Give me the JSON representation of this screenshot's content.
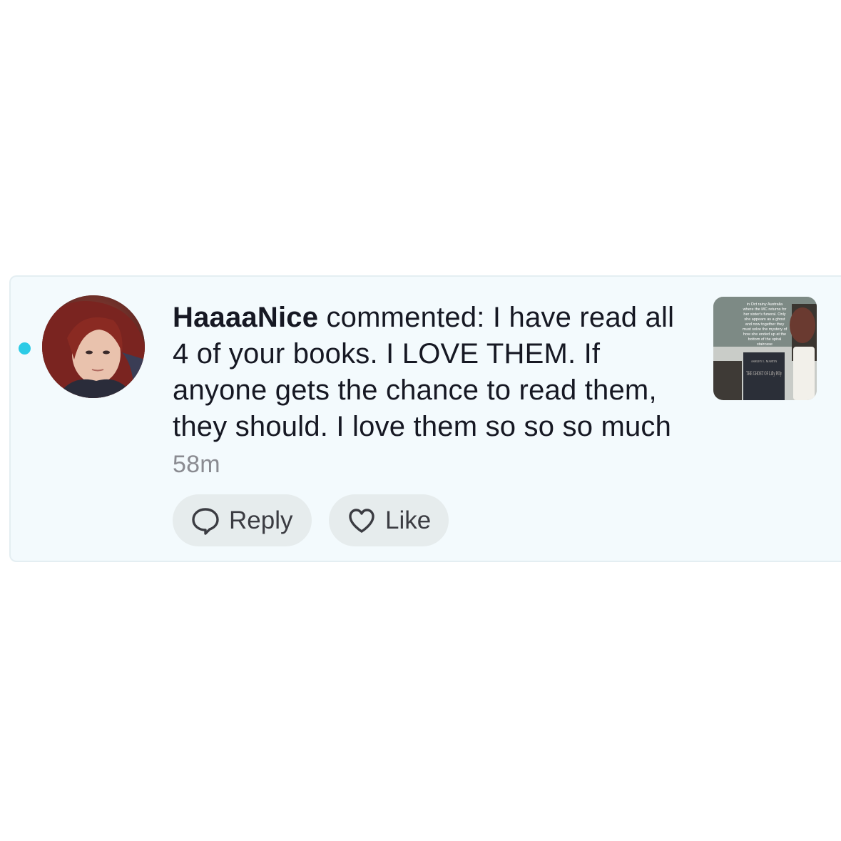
{
  "comment": {
    "username": "HaaaaNice",
    "action": " commented: ",
    "text": "I have read all 4 of your books. I LOVE THEM. If anyone gets the chance to read them, they should. I love them so so so much",
    "time": "58m"
  },
  "actions": {
    "reply_label": "Reply",
    "like_label": "Like"
  },
  "icons": {
    "reply": "speech-bubble-icon",
    "like": "heart-outline-icon"
  },
  "thumbnail": {
    "overlay_lines": [
      "in Oct rainy Australia",
      "where the MC returns for",
      "her sister's funeral. Only",
      "she appears as a ghost",
      "and now together they",
      "must solve the mystery of",
      "how she ended up at the",
      "bottom of the spiral",
      "staircase"
    ],
    "book_author": "ASHLEY L. MARTIN",
    "book_title": "THE GHOST OF Lilly Pilly"
  },
  "colors": {
    "card_background": "#f3fafd",
    "unread_dot": "#2ccbe6",
    "button_background": "#e6eced",
    "time_text": "#8a8b91"
  }
}
